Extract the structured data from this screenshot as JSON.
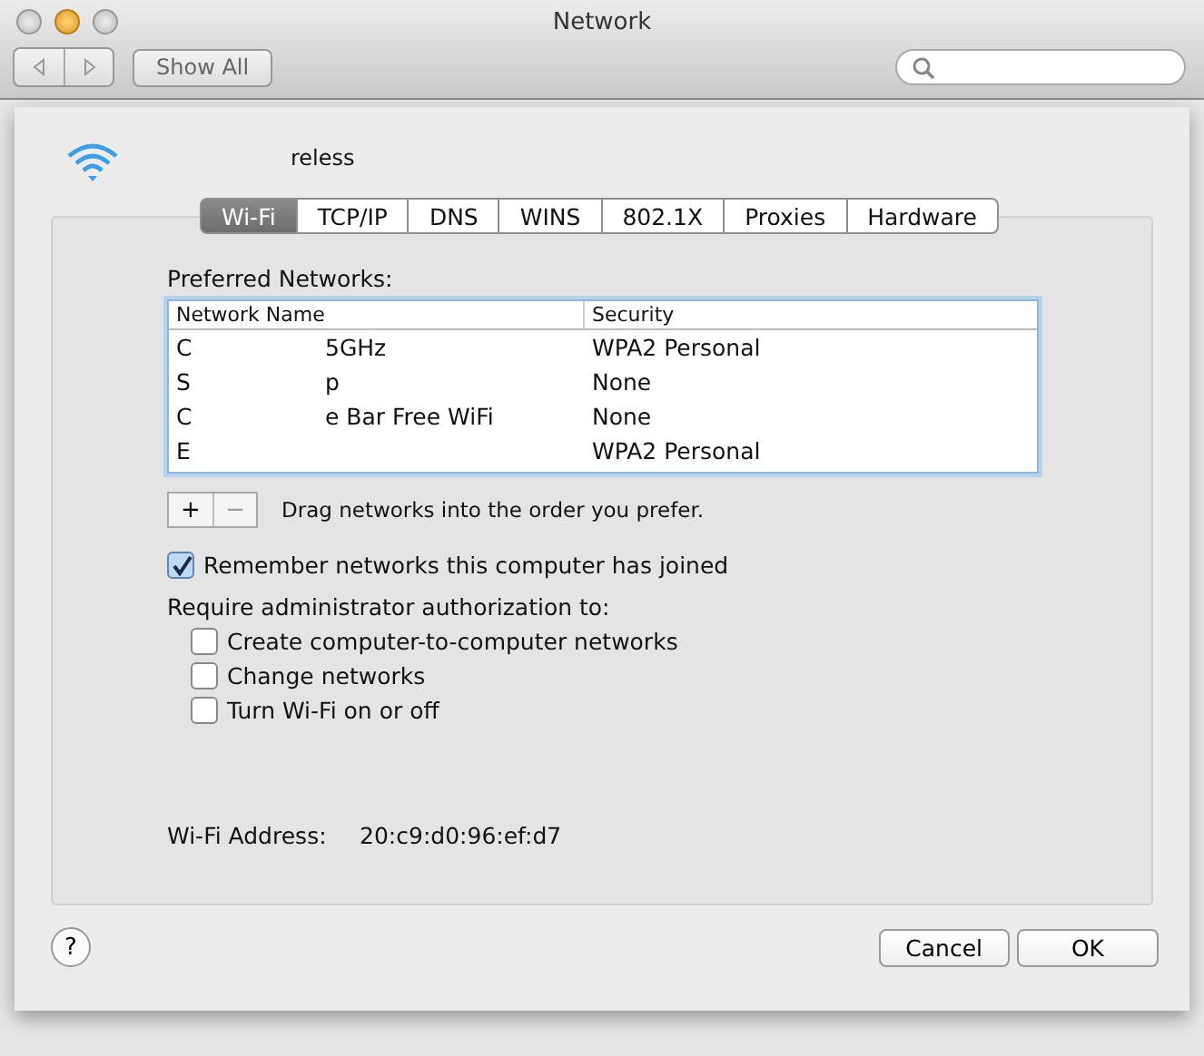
{
  "window": {
    "title": "Network"
  },
  "toolbar": {
    "show_all": "Show All"
  },
  "sheet": {
    "service_name": "reless",
    "tabs": [
      {
        "label": "Wi-Fi",
        "selected": true
      },
      {
        "label": "TCP/IP",
        "selected": false
      },
      {
        "label": "DNS",
        "selected": false
      },
      {
        "label": "WINS",
        "selected": false
      },
      {
        "label": "802.1X",
        "selected": false
      },
      {
        "label": "Proxies",
        "selected": false
      },
      {
        "label": "Hardware",
        "selected": false
      }
    ],
    "preferred_label": "Preferred Networks:",
    "table": {
      "columns": [
        "Network Name",
        "Security"
      ],
      "rows": [
        {
          "name_parts": [
            "C",
            "5GHz"
          ],
          "security": "WPA2 Personal"
        },
        {
          "name_parts": [
            "S",
            "p"
          ],
          "security": "None"
        },
        {
          "name_parts": [
            "C",
            "e Bar Free WiFi"
          ],
          "security": "None"
        },
        {
          "name_parts": [
            "E"
          ],
          "security": "WPA2 Personal"
        }
      ]
    },
    "add": "+",
    "remove": "−",
    "drag_hint": "Drag networks into the order you prefer.",
    "remember": {
      "label": "Remember networks this computer has joined",
      "checked": true
    },
    "require_label": "Require administrator authorization to:",
    "require_options": [
      {
        "label": "Create computer-to-computer networks",
        "checked": false
      },
      {
        "label": "Change networks",
        "checked": false
      },
      {
        "label": "Turn Wi-Fi on or off",
        "checked": false
      }
    ],
    "address_label": "Wi-Fi Address:",
    "address_value": "20:c9:d0:96:ef:d7",
    "help": "?",
    "buttons": [
      "Cancel",
      "OK"
    ]
  }
}
